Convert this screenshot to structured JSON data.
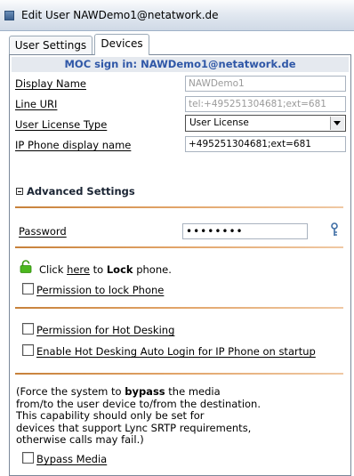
{
  "window": {
    "title": "Edit User NAWDemo1@netatwork.de"
  },
  "tabs": [
    {
      "label": "User Settings"
    },
    {
      "label": "Devices"
    }
  ],
  "banner": {
    "text": "MOC sign in: NAWDemo1@netatwork.de"
  },
  "fields": {
    "display_name": {
      "label": "Display Name",
      "value": "NAWDemo1"
    },
    "line_uri": {
      "label": "Line URI",
      "value": "tel:+495251304681;ext=681"
    },
    "license_type": {
      "label": "User License Type",
      "value": "User License"
    },
    "ip_phone_name": {
      "label": "IP Phone display name",
      "value": "+495251304681;ext=681"
    }
  },
  "advanced": {
    "heading": "Advanced Settings",
    "password": {
      "label": "Password",
      "value": "••••••••"
    },
    "lock": {
      "prefix": "Click ",
      "link": "here",
      "middle": " to ",
      "bold": "Lock",
      "suffix": " phone."
    },
    "checkboxes": {
      "permission_lock": {
        "label": "Permission to lock Phone",
        "checked": false
      },
      "permission_hot_desking": {
        "label": "Permission for Hot Desking",
        "checked": false
      },
      "hot_desking_auto_login": {
        "label": "Enable Hot Desking Auto Login for IP Phone on startup",
        "checked": false
      },
      "bypass_media": {
        "label": "Bypass Media",
        "checked": false
      }
    },
    "bypass_note": {
      "l1_a": "(Force the system to ",
      "l1_b": "bypass",
      "l1_c": " the media",
      "l2": "from/to the user device to/from the destination.",
      "l3": "This capability should only be set for",
      "l4": "devices that support Lync SRTP requirements,",
      "l5": "otherwise calls may fail.)"
    }
  },
  "colors": {
    "banner_text": "#2f57a7",
    "separator": "#c7813a",
    "lock_icon": "#4cb81e"
  },
  "icons": [
    "window-icon",
    "collapse-icon",
    "key-icon",
    "lock-icon",
    "dropdown-arrow-icon"
  ]
}
